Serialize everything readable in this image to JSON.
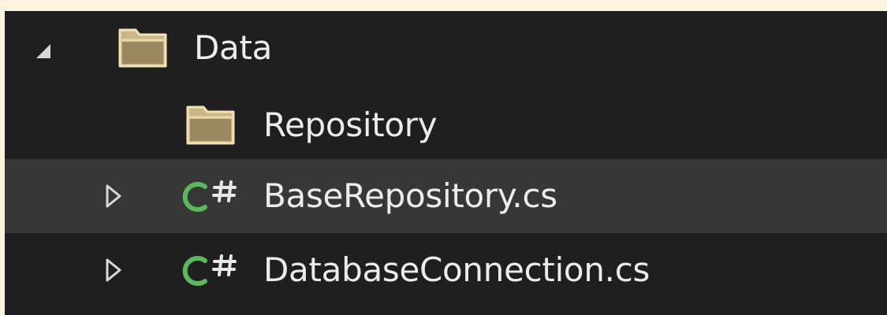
{
  "tree": {
    "items": [
      {
        "label": "Data",
        "icon": "folder-icon",
        "state": "expanded"
      },
      {
        "label": "Repository",
        "icon": "folder-icon",
        "state": "none"
      },
      {
        "label": "BaseRepository.cs",
        "icon": "csharp-file-icon",
        "state": "collapsed",
        "selected": true
      },
      {
        "label": "DatabaseConnection.cs",
        "icon": "csharp-file-icon",
        "state": "collapsed"
      }
    ]
  },
  "colors": {
    "page_background": "#fff3e0",
    "panel_background": "#1f1f1f",
    "selected_row": "#373737",
    "text": "#ececec",
    "folder": "#c9b88a",
    "csharp_icon": "#5cb85c"
  }
}
